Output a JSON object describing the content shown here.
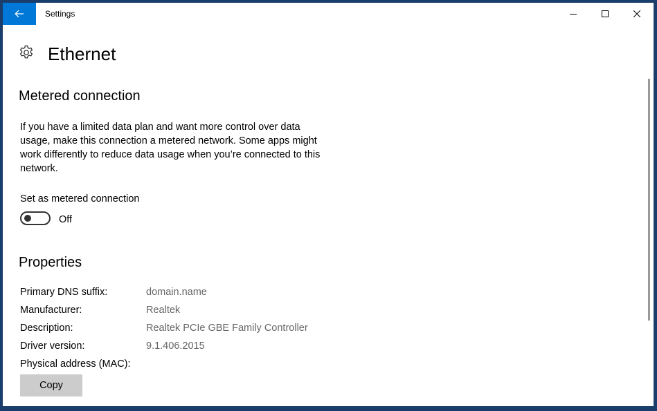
{
  "titlebar": {
    "app_title": "Settings",
    "icons": {
      "back": "back-arrow-icon",
      "minimize": "minimize-icon",
      "maximize": "maximize-icon",
      "close": "close-icon"
    }
  },
  "header": {
    "icon": "gear-icon",
    "title": "Ethernet"
  },
  "metered": {
    "section_title": "Metered connection",
    "description": "If you have a limited data plan and want more control over data usage, make this connection a metered network. Some apps might work differently to reduce data usage when you’re connected to this network.",
    "toggle_label": "Set as metered connection",
    "toggle_state": "Off",
    "toggle_on": false
  },
  "properties": {
    "section_title": "Properties",
    "rows": [
      {
        "label": "Primary DNS suffix:",
        "value": "domain.name"
      },
      {
        "label": "Manufacturer:",
        "value": "Realtek"
      },
      {
        "label": "Description:",
        "value": "Realtek PCIe GBE Family Controller"
      },
      {
        "label": "Driver version:",
        "value": "9.1.406.2015"
      },
      {
        "label": "Physical address (MAC):",
        "value": ""
      }
    ],
    "copy_label": "Copy"
  },
  "colors": {
    "accent": "#0078d7",
    "button_bg": "#cccccc",
    "value_text": "#666666"
  }
}
